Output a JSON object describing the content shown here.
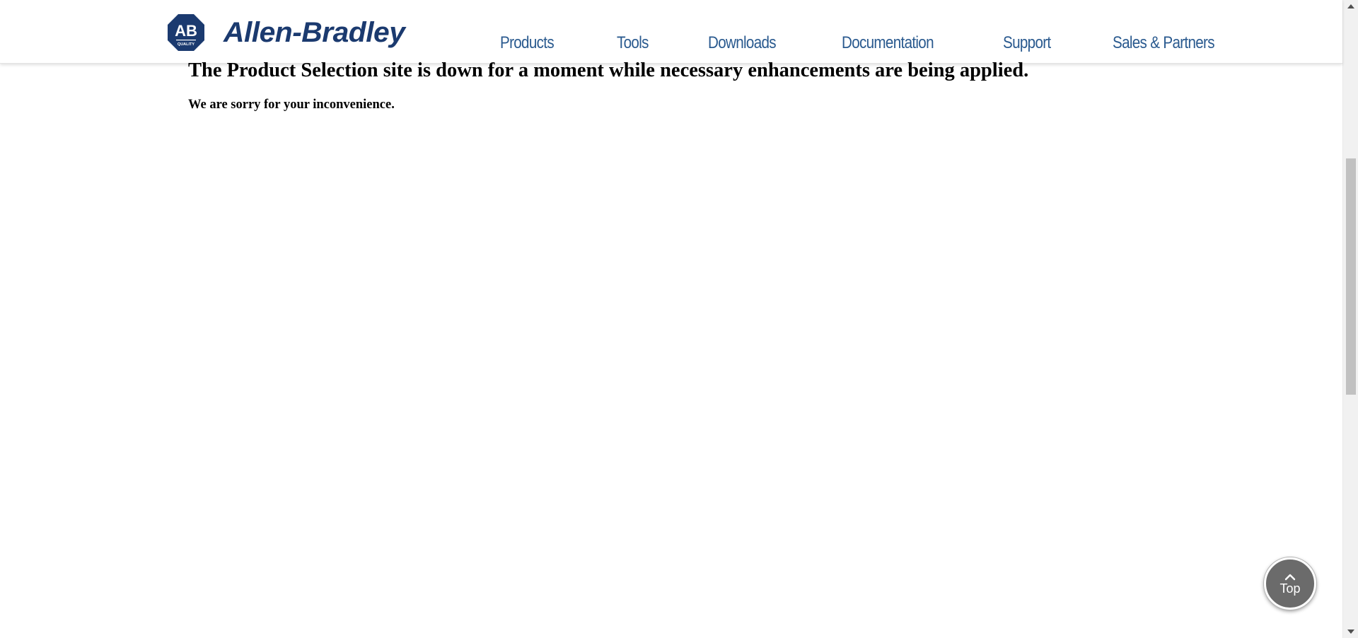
{
  "brand": {
    "badge_text": "AB",
    "badge_subtext": "QUALITY",
    "name": "Allen-Bradley",
    "color": "#1b3a6f"
  },
  "nav": {
    "items": [
      {
        "label": "Products"
      },
      {
        "label": "Tools"
      },
      {
        "label": "Downloads"
      },
      {
        "label": "Documentation"
      },
      {
        "label": "Support"
      },
      {
        "label": "Sales & Partners"
      }
    ],
    "color": "#2a5a8f"
  },
  "content": {
    "headline": "The Product Selection site is down for a moment while necessary enhancements are being applied.",
    "message": "We are sorry for your inconvenience."
  },
  "back_to_top": {
    "label": "Top",
    "icon": "chevron-up-icon",
    "color": "#6b6b6b"
  },
  "scrollbar": {
    "up_icon": "triangle-up-icon",
    "down_icon": "triangle-down-icon"
  }
}
